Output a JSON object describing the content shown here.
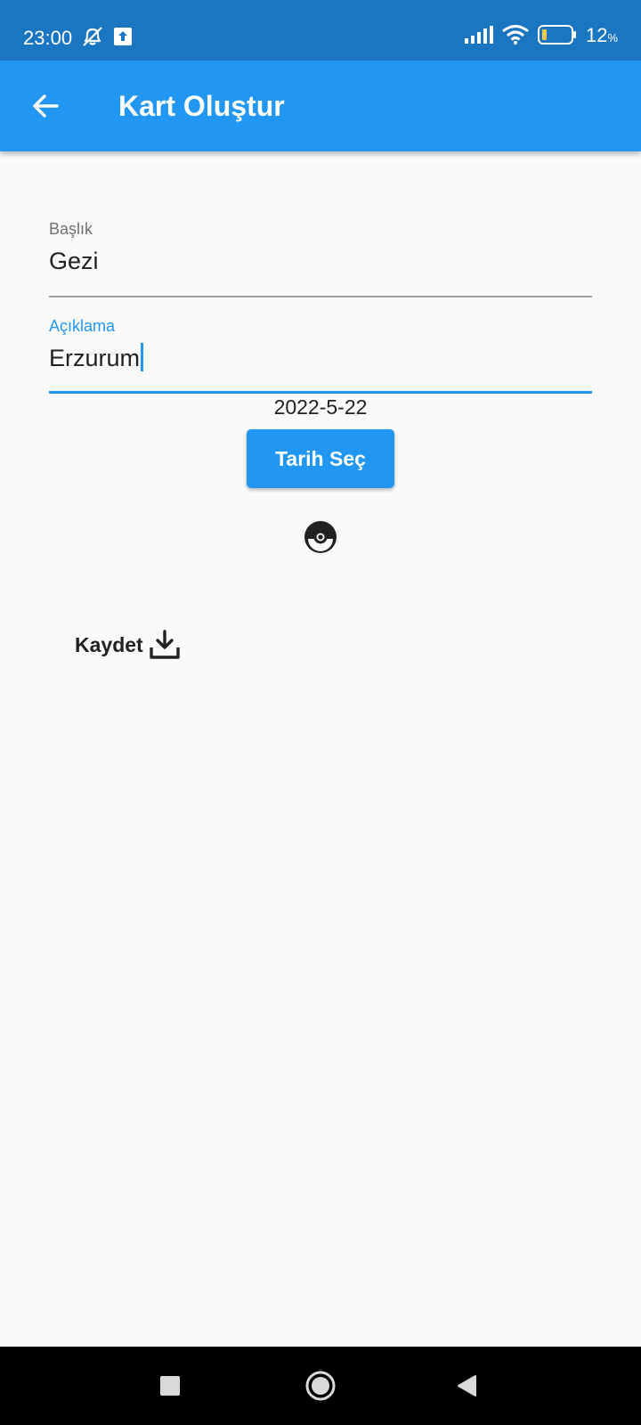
{
  "status_bar": {
    "time": "23:00",
    "battery_percent": "12",
    "battery_unit": "%",
    "icons": [
      "alarm-off-icon",
      "upload-icon",
      "signal-icon",
      "wifi-icon",
      "battery-icon"
    ]
  },
  "app_bar": {
    "title": "Kart Oluştur",
    "back_icon": "arrow-back-icon"
  },
  "form": {
    "title_label": "Başlık",
    "title_value": "Gezi",
    "description_label": "Açıklama",
    "description_value": "Erzurum",
    "date": "2022-5-22",
    "pick_date_label": "Tarih Seç",
    "image_icon": "pokeball-icon",
    "save_label": "Kaydet",
    "save_icon": "download-icon"
  },
  "nav_bar": {
    "icons": [
      "recents-icon",
      "home-icon",
      "back-icon"
    ]
  },
  "colors": {
    "primary": "#2196f3",
    "status_bar": "#1b76c1",
    "background": "#fafafa"
  }
}
